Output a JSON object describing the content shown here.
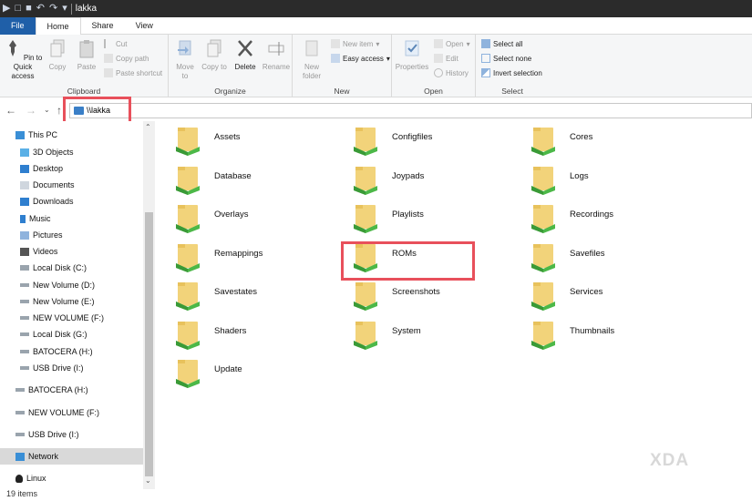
{
  "window": {
    "title": "lakka"
  },
  "tabs": [
    "File",
    "Home",
    "Share",
    "View"
  ],
  "ribbon": {
    "clipboard": {
      "label": "Clipboard",
      "pin": "Pin to Quick access",
      "copy": "Copy",
      "paste": "Paste",
      "cut": "Cut",
      "copy_path": "Copy path",
      "paste_shortcut": "Paste shortcut"
    },
    "organize": {
      "label": "Organize",
      "move_to": "Move to",
      "copy_to": "Copy to",
      "delete": "Delete",
      "rename": "Rename"
    },
    "new": {
      "label": "New",
      "new_folder": "New folder",
      "new_item": "New item",
      "easy_access": "Easy access"
    },
    "open": {
      "label": "Open",
      "properties": "Properties",
      "open": "Open",
      "edit": "Edit",
      "history": "History"
    },
    "select": {
      "label": "Select",
      "select_all": "Select all",
      "select_none": "Select none",
      "invert": "Invert selection"
    }
  },
  "address": {
    "path": "\\\\lakka"
  },
  "sidebar": [
    "This PC",
    "3D Objects",
    "Desktop",
    "Documents",
    "Downloads",
    "Music",
    "Pictures",
    "Videos",
    "Local Disk (C:)",
    "New Volume (D:)",
    "New Volume (E:)",
    "NEW VOLUME (F:)",
    "Local Disk (G:)",
    "BATOCERA (H:)",
    "USB Drive (I:)",
    "BATOCERA (H:)",
    "NEW VOLUME (F:)",
    "USB Drive (I:)",
    "Network",
    "Linux"
  ],
  "folders": [
    "Assets",
    "Configfiles",
    "Cores",
    "Database",
    "Joypads",
    "Logs",
    "Overlays",
    "Playlists",
    "Recordings",
    "Remappings",
    "ROMs",
    "Savefiles",
    "Savestates",
    "Screenshots",
    "Services",
    "Shaders",
    "System",
    "Thumbnails",
    "Update"
  ],
  "status": {
    "count": "19 items"
  },
  "watermark": "XDA",
  "colors": {
    "highlight": "#e8505b",
    "file_tab": "#1f5fa8",
    "selection": "#d9d9d9"
  }
}
